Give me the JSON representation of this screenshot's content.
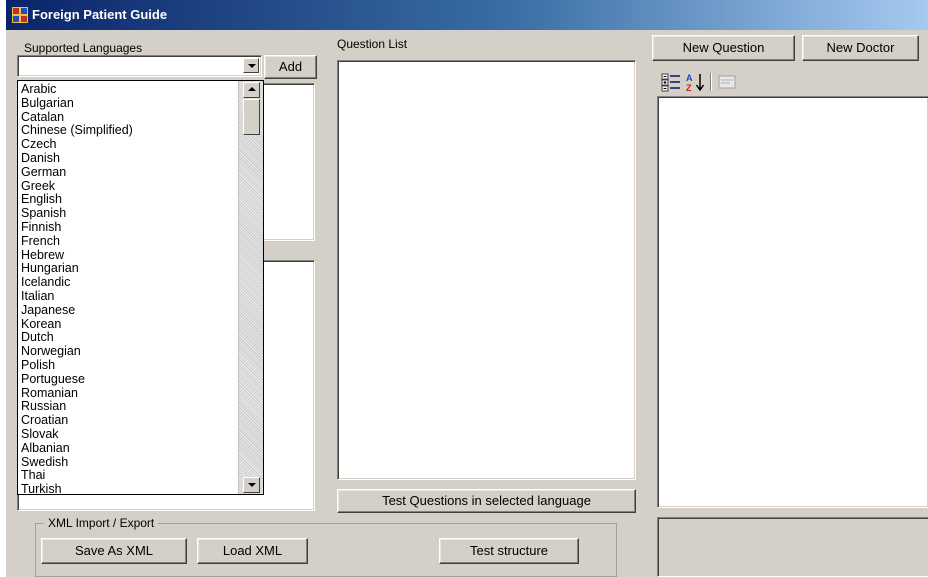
{
  "window": {
    "title": "Foreign Patient Guide"
  },
  "languages": {
    "label": "Supported Languages",
    "combo_value": "",
    "add_label": "Add",
    "options": [
      "Arabic",
      "Bulgarian",
      "Catalan",
      "Chinese (Simplified)",
      "Czech",
      "Danish",
      "German",
      "Greek",
      "English",
      "Spanish",
      "Finnish",
      "French",
      "Hebrew",
      "Hungarian",
      "Icelandic",
      "Italian",
      "Japanese",
      "Korean",
      "Dutch",
      "Norwegian",
      "Polish",
      "Portuguese",
      "Romanian",
      "Russian",
      "Croatian",
      "Slovak",
      "Albanian",
      "Swedish",
      "Thai",
      "Turkish"
    ]
  },
  "questions": {
    "label": "Question List",
    "test_button": "Test Questions in selected language"
  },
  "right": {
    "new_question": "New Question",
    "new_doctor": "New Doctor",
    "toolbar_icons": [
      "categorized-icon",
      "alphabetical-sort-icon",
      "property-pages-icon"
    ]
  },
  "xml": {
    "group_label": "XML Import / Export",
    "save_label": "Save As XML",
    "load_label": "Load XML",
    "test_label": "Test structure"
  }
}
